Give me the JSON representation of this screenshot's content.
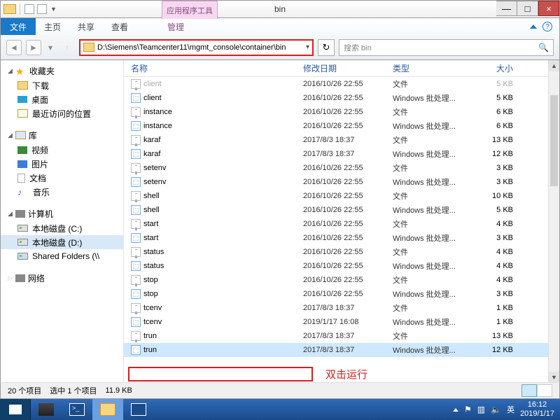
{
  "titlebar": {
    "context_tab": "应用程序工具",
    "title": "bin"
  },
  "win_buttons": {
    "min": "—",
    "max": "□",
    "close": "×"
  },
  "ribbon": {
    "file": "文件",
    "tabs": [
      "主页",
      "共享",
      "查看"
    ],
    "context_tab": "管理"
  },
  "address": {
    "path": "D:\\Siemens\\Teamcenter11\\mgmt_console\\container\\bin",
    "refresh": "↻",
    "search_placeholder": "搜索 bin",
    "search_icon": "🔍"
  },
  "nav": {
    "favorites": {
      "label": "收藏夹",
      "items": [
        "下载",
        "桌面",
        "最近访问的位置"
      ]
    },
    "libraries": {
      "label": "库",
      "items": [
        "视频",
        "图片",
        "文档",
        "音乐"
      ]
    },
    "computer": {
      "label": "计算机",
      "items": [
        {
          "label": "本地磁盘 (C:)"
        },
        {
          "label": "本地磁盘 (D:)",
          "selected": true
        },
        {
          "label": "Shared Folders (\\\\"
        }
      ]
    },
    "network": {
      "label": "网络"
    }
  },
  "columns": {
    "name": "名称",
    "date": "修改日期",
    "type": "类型",
    "size": "大小"
  },
  "files": [
    {
      "name": "client",
      "date": "2016/10/26 22:55",
      "type": "文件",
      "size": "5 KB",
      "icon": "doc",
      "cut": true
    },
    {
      "name": "client",
      "date": "2016/10/26 22:55",
      "type": "Windows 批处理...",
      "size": "5 KB",
      "icon": "bat"
    },
    {
      "name": "instance",
      "date": "2016/10/26 22:55",
      "type": "文件",
      "size": "6 KB",
      "icon": "doc"
    },
    {
      "name": "instance",
      "date": "2016/10/26 22:55",
      "type": "Windows 批处理...",
      "size": "6 KB",
      "icon": "bat"
    },
    {
      "name": "karaf",
      "date": "2017/8/3 18:37",
      "type": "文件",
      "size": "13 KB",
      "icon": "doc"
    },
    {
      "name": "karaf",
      "date": "2017/8/3 18:37",
      "type": "Windows 批处理...",
      "size": "12 KB",
      "icon": "bat"
    },
    {
      "name": "setenv",
      "date": "2016/10/26 22:55",
      "type": "文件",
      "size": "3 KB",
      "icon": "doc"
    },
    {
      "name": "setenv",
      "date": "2016/10/26 22:55",
      "type": "Windows 批处理...",
      "size": "3 KB",
      "icon": "bat"
    },
    {
      "name": "shell",
      "date": "2016/10/26 22:55",
      "type": "文件",
      "size": "10 KB",
      "icon": "doc"
    },
    {
      "name": "shell",
      "date": "2016/10/26 22:55",
      "type": "Windows 批处理...",
      "size": "5 KB",
      "icon": "bat"
    },
    {
      "name": "start",
      "date": "2016/10/26 22:55",
      "type": "文件",
      "size": "4 KB",
      "icon": "doc"
    },
    {
      "name": "start",
      "date": "2016/10/26 22:55",
      "type": "Windows 批处理...",
      "size": "3 KB",
      "icon": "bat"
    },
    {
      "name": "status",
      "date": "2016/10/26 22:55",
      "type": "文件",
      "size": "4 KB",
      "icon": "doc"
    },
    {
      "name": "status",
      "date": "2016/10/26 22:55",
      "type": "Windows 批处理...",
      "size": "4 KB",
      "icon": "bat"
    },
    {
      "name": "stop",
      "date": "2016/10/26 22:55",
      "type": "文件",
      "size": "4 KB",
      "icon": "doc"
    },
    {
      "name": "stop",
      "date": "2016/10/26 22:55",
      "type": "Windows 批处理...",
      "size": "3 KB",
      "icon": "bat"
    },
    {
      "name": "tcenv",
      "date": "2017/8/3 18:37",
      "type": "文件",
      "size": "1 KB",
      "icon": "doc"
    },
    {
      "name": "tcenv",
      "date": "2019/1/17 16:08",
      "type": "Windows 批处理...",
      "size": "1 KB",
      "icon": "bat"
    },
    {
      "name": "trun",
      "date": "2017/8/3 18:37",
      "type": "文件",
      "size": "13 KB",
      "icon": "doc"
    },
    {
      "name": "trun",
      "date": "2017/8/3 18:37",
      "type": "Windows 批处理...",
      "size": "12 KB",
      "icon": "bat",
      "selected": true
    }
  ],
  "annotation": {
    "label": "双击运行"
  },
  "status": {
    "count": "20 个项目",
    "selection": "选中 1 个项目",
    "size": "11.9 KB"
  },
  "taskbar": {
    "tray_lang": "英",
    "clock_time": "16:12",
    "clock_date": "2019/1/17"
  }
}
